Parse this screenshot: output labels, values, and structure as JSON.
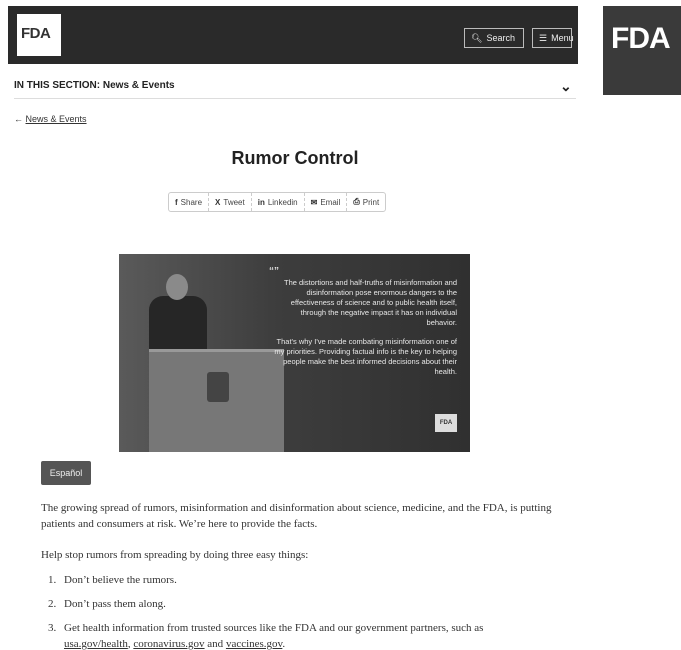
{
  "header": {
    "logo_text": "FDA",
    "search_label": "Search",
    "menu_label": "Menu"
  },
  "side_logo": {
    "text": "FDA"
  },
  "section": {
    "label": "IN THIS SECTION: News & Events"
  },
  "breadcrumb": {
    "back_label": "News & Events"
  },
  "page": {
    "title": "Rumor Control"
  },
  "share": {
    "items": [
      {
        "label": "Share",
        "icon": "facebook-icon"
      },
      {
        "label": "Tweet",
        "icon": "twitter-icon"
      },
      {
        "label": "Linkedin",
        "icon": "linkedin-icon"
      },
      {
        "label": "Email",
        "icon": "email-icon"
      },
      {
        "label": "Print",
        "icon": "print-icon"
      }
    ]
  },
  "hero": {
    "quote_p1": "The distortions and half-truths of misinformation and disinformation pose enormous dangers to the effectiveness of science and to public health itself, through the negative impact it has on individual behavior.",
    "quote_p2": "That's why I've made combating misinformation one of my priorities. Providing factual info is the key to helping people make the best informed decisions about their health.",
    "badge": "FDA"
  },
  "espanol_label": "Español",
  "content": {
    "p1": "The growing spread of rumors, misinformation and disinformation about science, medicine, and the FDA, is putting patients and consumers at risk. We’re here to provide the facts.",
    "p2": "Help stop rumors from spreading by doing three easy things:",
    "steps": [
      {
        "num": "1.",
        "text": "Don’t believe the rumors."
      },
      {
        "num": "2.",
        "text": "Don’t pass them along."
      },
      {
        "num": "3.",
        "text": "Get health information from trusted sources like the FDA and our government partners, such as",
        "link1": "usa.gov/health",
        "sep1": ",",
        "link2": "coronavirus.gov",
        "sep2": "and",
        "link3": "vaccines.gov",
        "end": "."
      }
    ]
  }
}
